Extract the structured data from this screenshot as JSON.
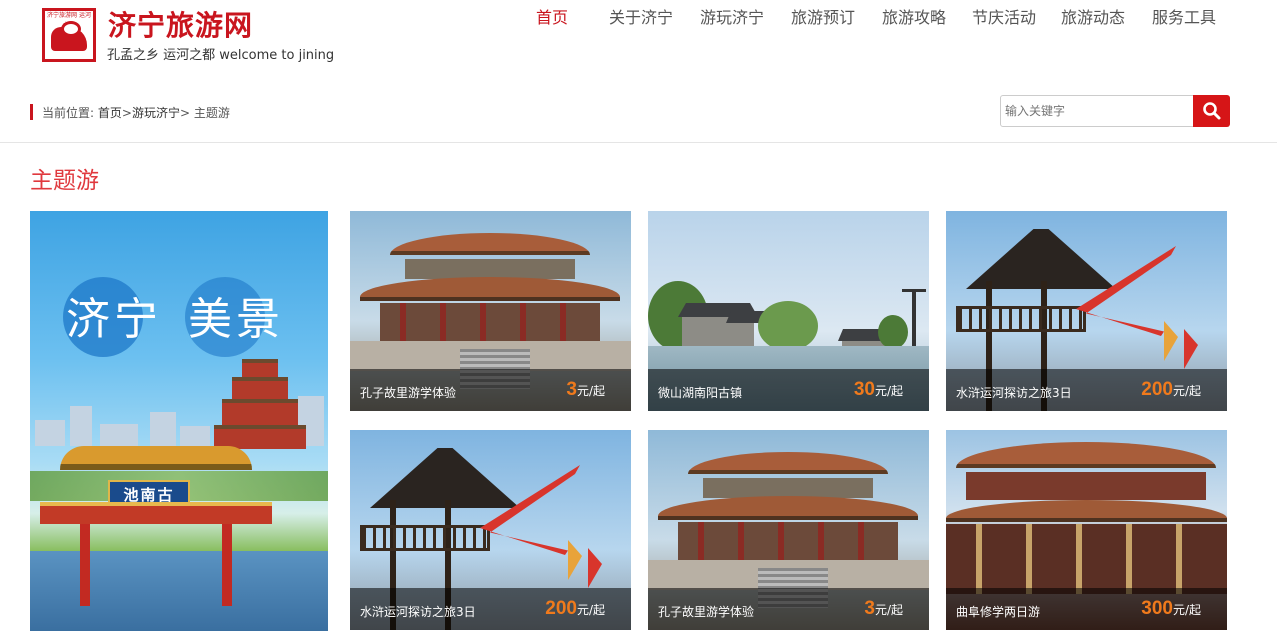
{
  "site": {
    "title": "济宁旅游网",
    "slogan": "孔孟之乡 运河之都 welcome to jining",
    "logo_tiny_text": "济宁旅游网 运河之都"
  },
  "nav": {
    "items": [
      {
        "label": "首页",
        "active": true
      },
      {
        "label": "关于济宁",
        "active": false
      },
      {
        "label": "游玩济宁",
        "active": false
      },
      {
        "label": "旅游预订",
        "active": false
      },
      {
        "label": "旅游攻略",
        "active": false
      },
      {
        "label": "节庆活动",
        "active": false
      },
      {
        "label": "旅游动态",
        "active": false
      },
      {
        "label": "服务工具",
        "active": false
      }
    ]
  },
  "breadcrumb": {
    "prefix": "当前位置:",
    "home": "首页",
    "sep1": ">",
    "parent": "游玩济宁",
    "sep2": ">",
    "current": "主题游"
  },
  "search": {
    "placeholder": "输入关键字",
    "button_icon": "search-icon"
  },
  "section": {
    "title": "主题游"
  },
  "banner": {
    "text_left": "济宁",
    "text_right": "美景",
    "plaque": "池南古"
  },
  "cards": [
    {
      "name": "孔子故里游学体验",
      "price": "3",
      "unit": "元/起",
      "image": "temple"
    },
    {
      "name": "微山湖南阳古镇",
      "price": "30",
      "unit": "元/起",
      "image": "old-town"
    },
    {
      "name": "水浒运河探访之旅3日",
      "price": "200",
      "unit": "元/起",
      "image": "pavilion"
    },
    {
      "name": "水浒运河探访之旅3日",
      "price": "200",
      "unit": "元/起",
      "image": "pavilion"
    },
    {
      "name": "孔子故里游学体验",
      "price": "3",
      "unit": "元/起",
      "image": "temple"
    },
    {
      "name": "曲阜修学两日游",
      "price": "300",
      "unit": "元/起",
      "image": "temple-front"
    }
  ],
  "colors": {
    "brand_red": "#c9151e",
    "price_orange": "#f07a1c",
    "search_button": "#d61517"
  }
}
